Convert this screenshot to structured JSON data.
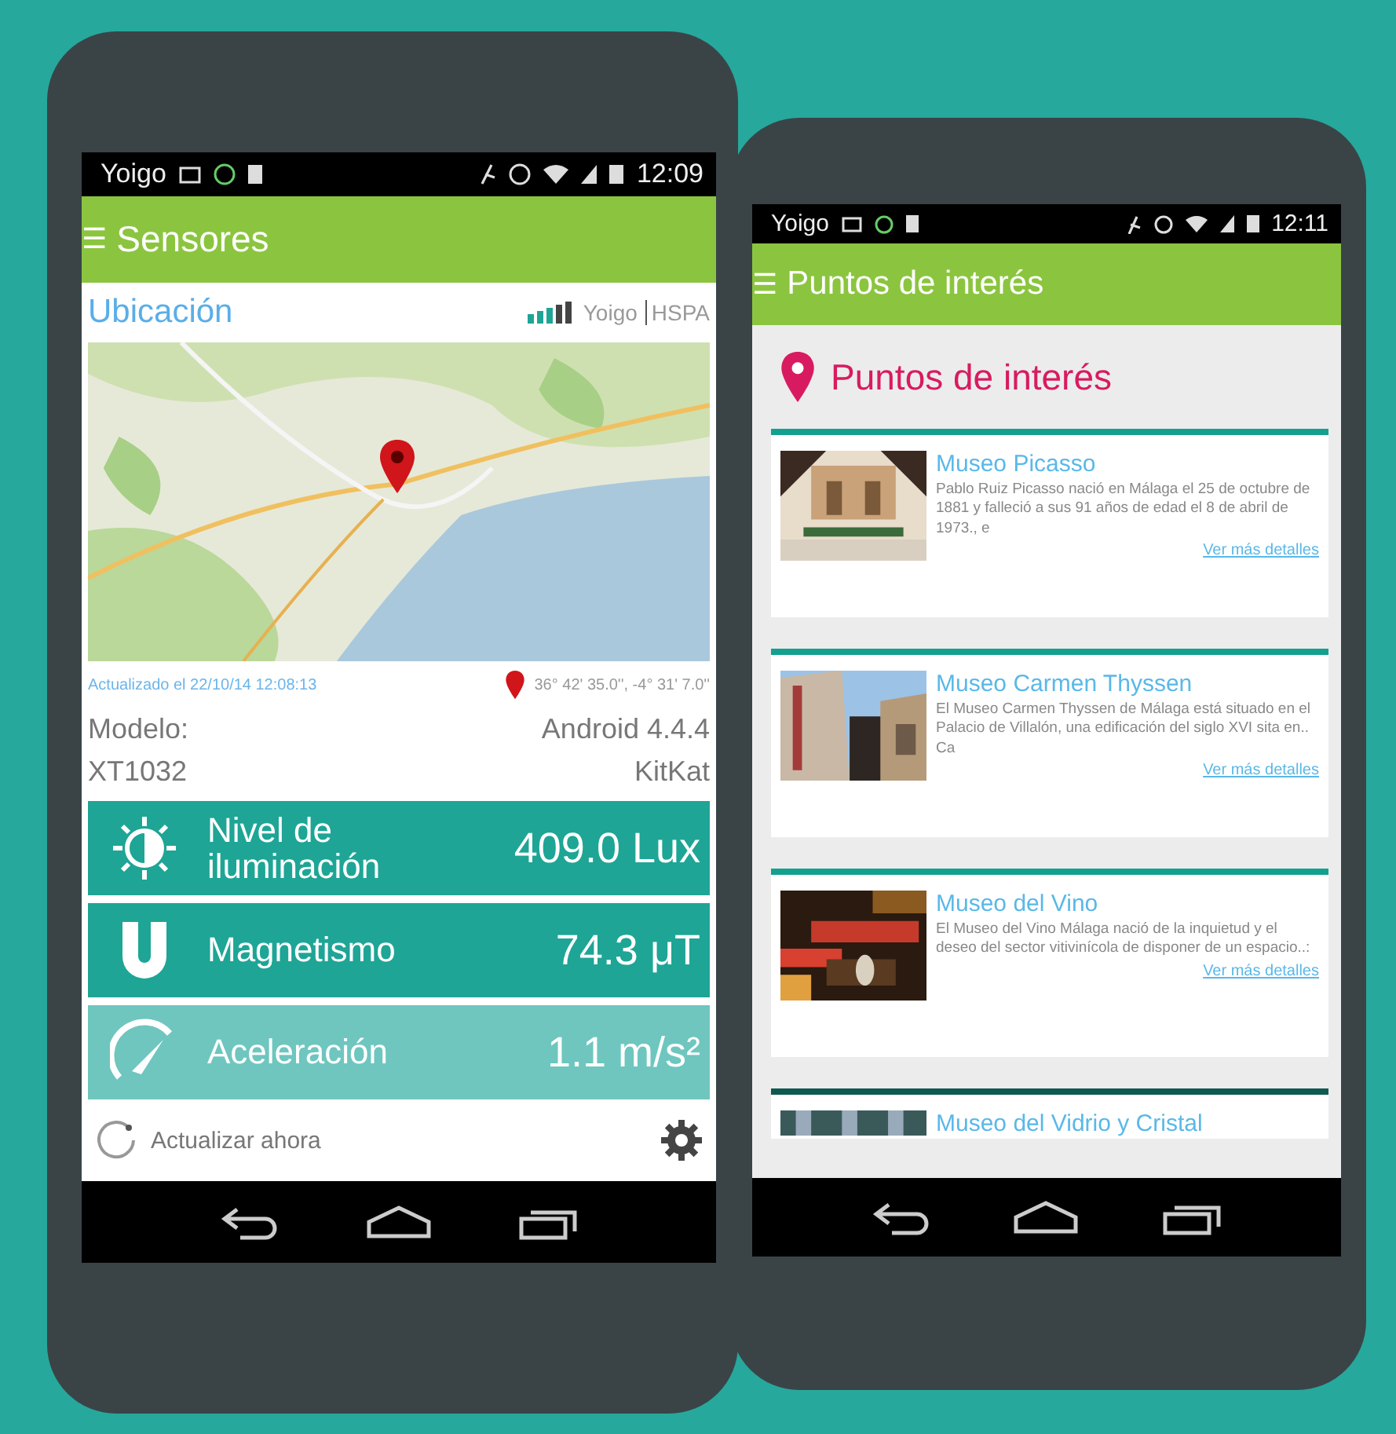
{
  "phones": [
    {
      "status_bar": {
        "carrier": "Yoigo",
        "time": "12:09"
      },
      "app_bar": {
        "menu_glyph": "☰",
        "title": "Sensores"
      },
      "location": {
        "title": "Ubicación",
        "network": "Yoigo",
        "network_type": "HSPA",
        "updated": "Actualizado el 22/10/14 12:08:13",
        "coordinates": "36° 42' 35.0'', -4° 31' 7.0''"
      },
      "device": [
        {
          "label": "Modelo:",
          "value": "Android 4.4.4"
        },
        {
          "label": "XT1032",
          "value": "KitKat"
        }
      ],
      "sensors": [
        {
          "kind": "light",
          "name": "Nivel de iluminación",
          "reading": "409.0 Lux",
          "color": "#1ea596"
        },
        {
          "kind": "magnet",
          "name": "Magnetismo",
          "reading": "74.3 μT",
          "color": "#1ea596"
        },
        {
          "kind": "gauge",
          "name": "Aceleración",
          "reading": "1.1 m/s²",
          "color": "#6ec6bf"
        }
      ],
      "refresh": "Actualizar ahora"
    },
    {
      "status_bar": {
        "carrier": "Yoigo",
        "time": "12:11"
      },
      "app_bar": {
        "menu_glyph": "☰",
        "title": "Puntos de interés"
      },
      "heading": "Puntos de interés",
      "places": [
        {
          "title": "Museo Picasso",
          "description": "Pablo Ruiz Picasso nació en Málaga el 25 de octubre de 1881 y falleció a sus 91 años de edad el 8 de abril de 1973., e",
          "link": "Ver más detalles"
        },
        {
          "title": "Museo Carmen Thyssen",
          "description": "El Museo Carmen Thyssen de Málaga está situado en el Palacio de Villalón, una edificación del siglo XVI sita en.. Ca",
          "link": "Ver más detalles"
        },
        {
          "title": "Museo del Vino",
          "description": "El Museo del Vino Málaga nació de la inquietud y el deseo del sector vitivinícola de disponer de un espacio..:",
          "link": "Ver más detalles"
        },
        {
          "title": "Museo del Vidrio y Cristal"
        }
      ]
    }
  ]
}
